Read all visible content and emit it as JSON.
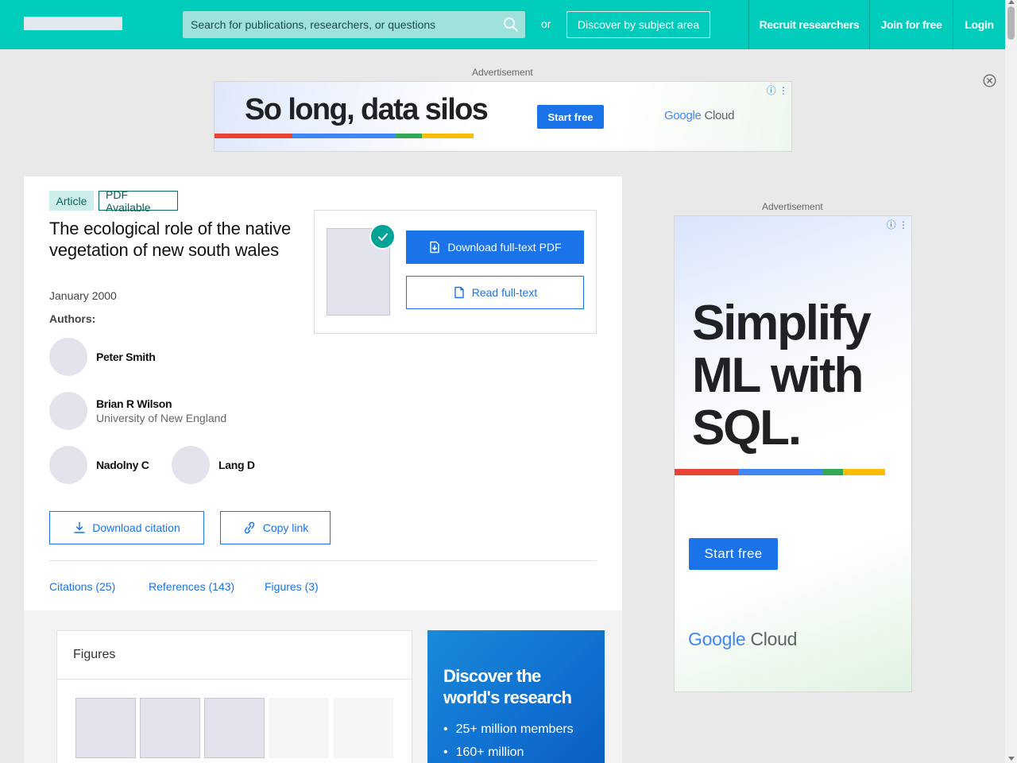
{
  "header": {
    "search_placeholder": "Search for publications, researchers, or questions",
    "or_text": "or",
    "discover_label": "Discover by subject area",
    "nav": {
      "recruit": "Recruit researchers",
      "join": "Join for free",
      "login": "Login"
    },
    "brand_color": "#00ccbb"
  },
  "ads": {
    "label": "Advertisement",
    "top": {
      "headline": "So long, data silos",
      "cta": "Start free",
      "brand_google": "Google",
      "brand_cloud": "Cloud"
    },
    "side": {
      "headline_lines": [
        "Simplify",
        "ML with",
        "SQL."
      ],
      "cta": "Start free",
      "brand_google": "Google",
      "brand_cloud": "Cloud"
    }
  },
  "publication": {
    "badges": {
      "type": "Article",
      "availability": "PDF Available"
    },
    "title": "The ecological role of the native vegetation of new south wales",
    "date": "January 2000",
    "authors_label": "Authors:",
    "authors": [
      {
        "name": "Peter Smith",
        "institution": ""
      },
      {
        "name": "Brian R Wilson",
        "institution": "University of New England"
      },
      {
        "name": "Nadolny C",
        "institution": ""
      },
      {
        "name": "Lang D",
        "institution": ""
      }
    ],
    "actions": {
      "download_pdf": "Download full-text PDF",
      "read_fulltext": "Read full-text",
      "download_citation": "Download citation",
      "copy_link": "Copy link"
    },
    "tabs": [
      {
        "label": "Citations (25)"
      },
      {
        "label": "References (143)"
      },
      {
        "label": "Figures (3)"
      }
    ]
  },
  "figures": {
    "title": "Figures"
  },
  "promo": {
    "title": "Discover the world's research",
    "items": [
      "25+ million members",
      "160+ million"
    ]
  },
  "colors": {
    "accent": "#1a73e8",
    "teal": "#00a497",
    "google_red": "#ea4335",
    "google_blue": "#4285f4",
    "google_green": "#34a853",
    "google_yellow": "#fbbc04"
  }
}
